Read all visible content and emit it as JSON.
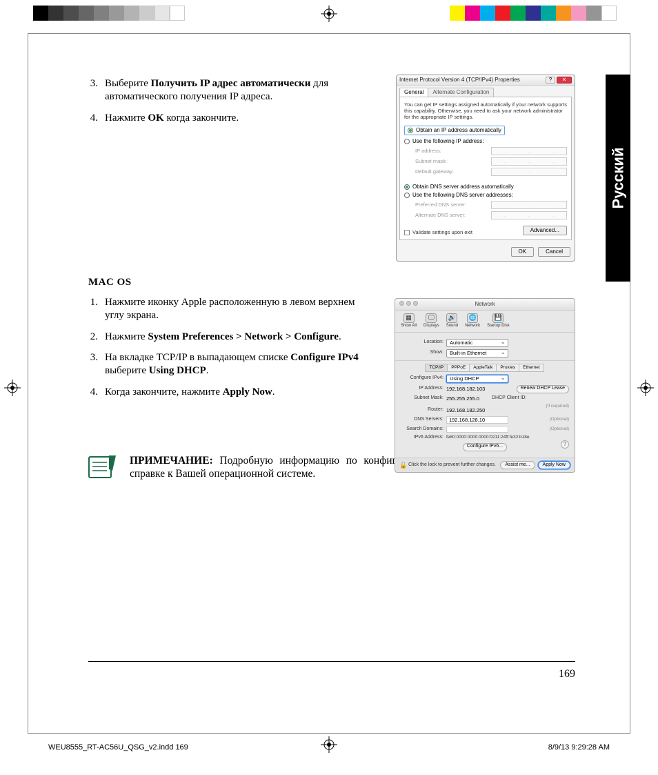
{
  "lang_tab": "Русский",
  "steps_windows": [
    {
      "num": "3.",
      "pre": "Выберите ",
      "bold": "Получить IP адрес автоматически",
      "post": " для автоматического получения IP адреса."
    },
    {
      "num": "4.",
      "pre": "Нажмите ",
      "bold": "OK",
      "post": " когда закончите."
    }
  ],
  "macos_heading": "MAC OS",
  "steps_mac": [
    {
      "num": "1.",
      "pre": "Нажмите иконку Apple",
      "icon": "",
      "post": " расположенную в левом верхнем углу экрана."
    },
    {
      "num": "2.",
      "pre": "Нажмите ",
      "bold": "System Preferences > Network > Configure",
      "post": "."
    },
    {
      "num": "3.",
      "pre": "На вкладке TCP/IP в выпадающем списке ",
      "bold": "Configure IPv4",
      "mid": " выберите ",
      "bold2": "Using DHCP",
      "post": "."
    },
    {
      "num": "4.",
      "pre": "Когда закончите, нажмите ",
      "bold": "Apply Now",
      "post": "."
    }
  ],
  "note": {
    "label": "ПРИМЕЧАНИЕ:",
    "text": " Подробную информацию по конфигурации настроек TCP/IP смотрите в справке к Вашей операционной системе."
  },
  "page_number": "169",
  "slug": {
    "file": "WEU8555_RT-AC56U_QSG_v2.indd   169",
    "datetime": "8/9/13   9:29:28 AM"
  },
  "win_dialog": {
    "title": "Internet Protocol Version 4 (TCP/IPv4) Properties",
    "tabs": {
      "general": "General",
      "alt": "Alternate Configuration"
    },
    "desc": "You can get IP settings assigned automatically if your network supports this capability. Otherwise, you need to ask your network administrator for the appropriate IP settings.",
    "opt_auto_ip": "Obtain an IP address automatically",
    "opt_use_ip": "Use the following IP address:",
    "ip_address": "IP address:",
    "subnet": "Subnet mask:",
    "gateway": "Default gateway:",
    "opt_auto_dns": "Obtain DNS server address automatically",
    "opt_use_dns": "Use the following DNS server addresses:",
    "pref_dns": "Preferred DNS server:",
    "alt_dns": "Alternate DNS server:",
    "validate": "Validate settings upon exit",
    "advanced": "Advanced...",
    "ok": "OK",
    "cancel": "Cancel"
  },
  "mac_dialog": {
    "title": "Network",
    "toolbar": {
      "showall": "Show All",
      "displays": "Displays",
      "sound": "Sound",
      "network": "Network",
      "startup": "Startup Disk"
    },
    "location_label": "Location:",
    "location_value": "Automatic",
    "show_label": "Show:",
    "show_value": "Built-in Ethernet",
    "tabs": [
      "TCP/IP",
      "PPPoE",
      "AppleTalk",
      "Proxies",
      "Ethernet"
    ],
    "cfg_label": "Configure IPv4:",
    "cfg_value": "Using DHCP",
    "ip_label": "IP Address:",
    "ip_value": "192.168.182.103",
    "renew": "Renew DHCP Lease",
    "subnet_label": "Subnet Mask:",
    "subnet_value": "255.255.255.0",
    "client_label": "DHCP Client ID:",
    "client_hint": "(If required)",
    "router_label": "Router:",
    "router_value": "192.168.182.250",
    "dns_label": "DNS Servers:",
    "dns_value": "192.168.128.10",
    "optional": "(Optional)",
    "search_label": "Search Domains:",
    "ipv6_label": "IPv6 Address:",
    "ipv6_value": "fe80:0000:0000:0000:0211:24ff:fe32:b18e",
    "cfg_ipv6": "Configure IPv6...",
    "lock": "Click the lock to prevent further changes.",
    "assist": "Assist me...",
    "apply": "Apply Now"
  }
}
